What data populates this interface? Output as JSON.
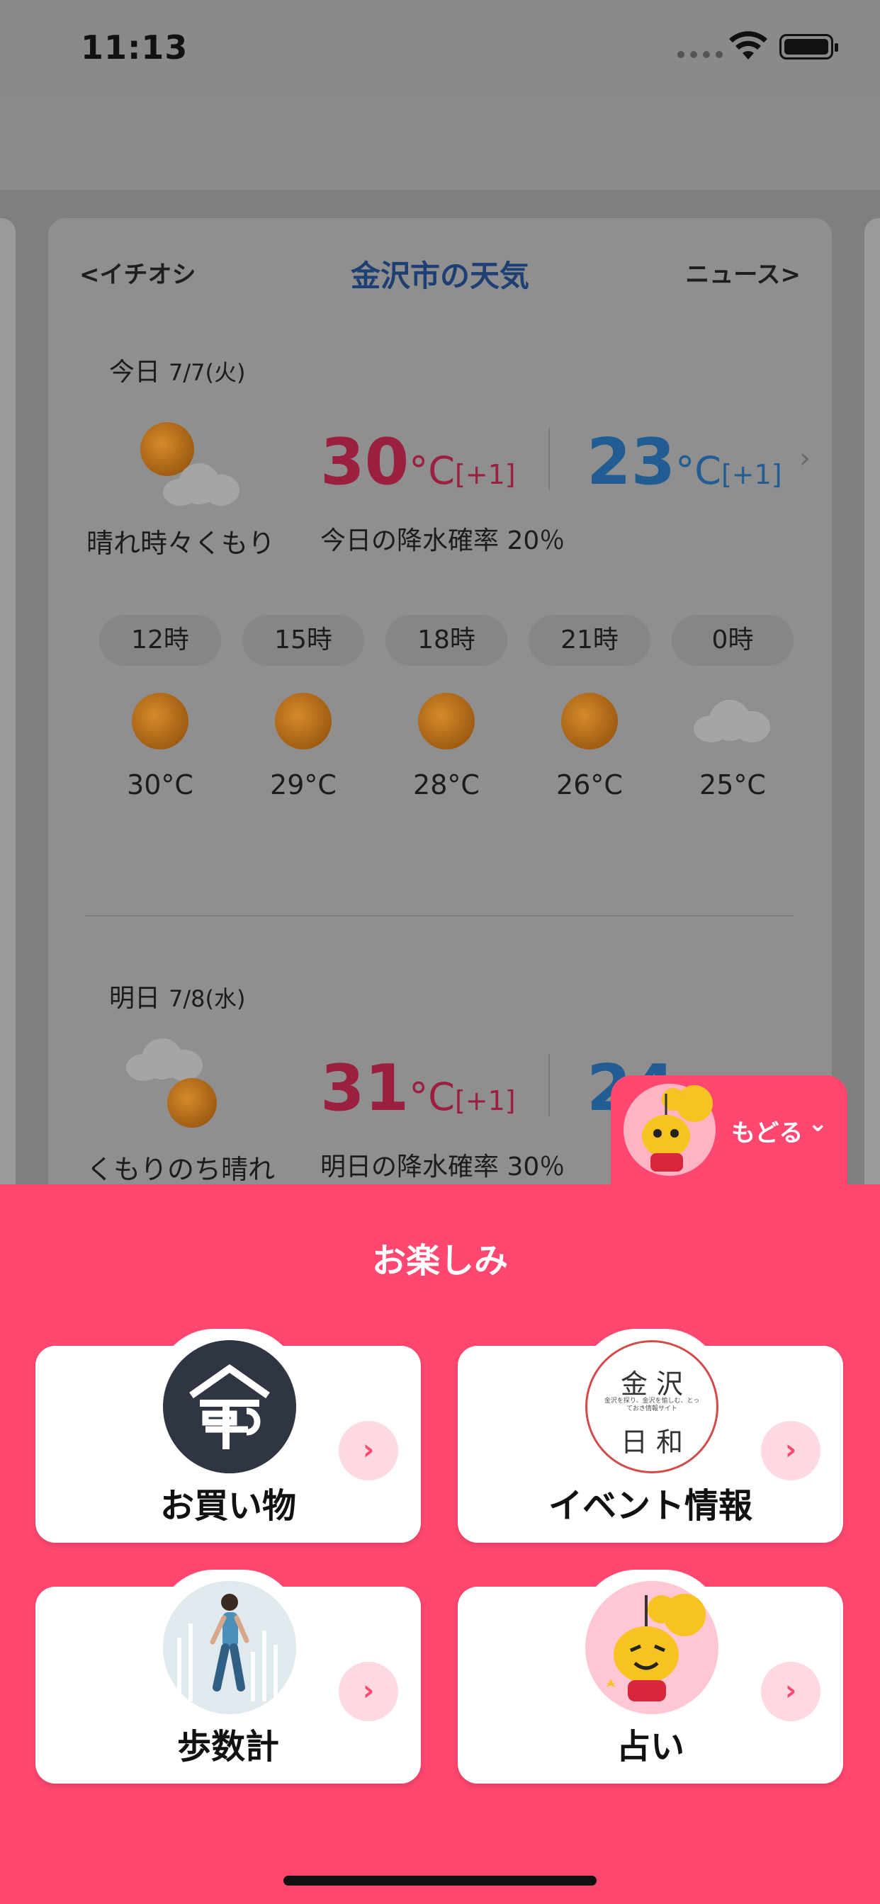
{
  "status_bar": {
    "time": "11:13"
  },
  "weather": {
    "nav_prev": "<イチオシ",
    "title": "金沢市の天気",
    "nav_next": "ニュース>",
    "today": {
      "label": "今日",
      "date": "7/7(火)",
      "condition": "晴れ時々くもり",
      "high": "30",
      "high_unit": "°C",
      "high_diff": "[+1]",
      "low": "23",
      "low_unit": "°C",
      "low_diff": "[+1]",
      "rain": "今日の降水確率 20％"
    },
    "hourly": [
      {
        "time": "12時",
        "temp": "30°C",
        "icon": "sun-icon"
      },
      {
        "time": "15時",
        "temp": "29°C",
        "icon": "sun-icon"
      },
      {
        "time": "18時",
        "temp": "28°C",
        "icon": "sun-icon"
      },
      {
        "time": "21時",
        "temp": "26°C",
        "icon": "sun-icon"
      },
      {
        "time": "0時",
        "temp": "25°C",
        "icon": "cloud-icon"
      }
    ],
    "tomorrow": {
      "label": "明日",
      "date": "7/8(水)",
      "condition": "くもりのち晴れ",
      "high": "31",
      "high_unit": "°C",
      "high_diff": "[+1]",
      "low": "24",
      "rain": "明日の降水確率 30％"
    }
  },
  "back_button": {
    "label": "もどる"
  },
  "sheet": {
    "title": "お楽しみ",
    "tiles": [
      {
        "label": "お買い物",
        "icon": "shopping-logo-icon"
      },
      {
        "label": "イベント情報",
        "icon": "kanazawa-biyori-logo-icon",
        "logo_text_top": "金 沢",
        "logo_text_bottom": "日 和",
        "logo_subtext": "金沢を探り、金沢を愉しむ、とっておき情報サイト"
      },
      {
        "label": "歩数計",
        "icon": "walking-woman-icon"
      },
      {
        "label": "占い",
        "icon": "mascot-icon"
      }
    ]
  },
  "colors": {
    "accent": "#ff476f",
    "high_temp": "#c8284f",
    "low_temp": "#2e7bc4"
  }
}
